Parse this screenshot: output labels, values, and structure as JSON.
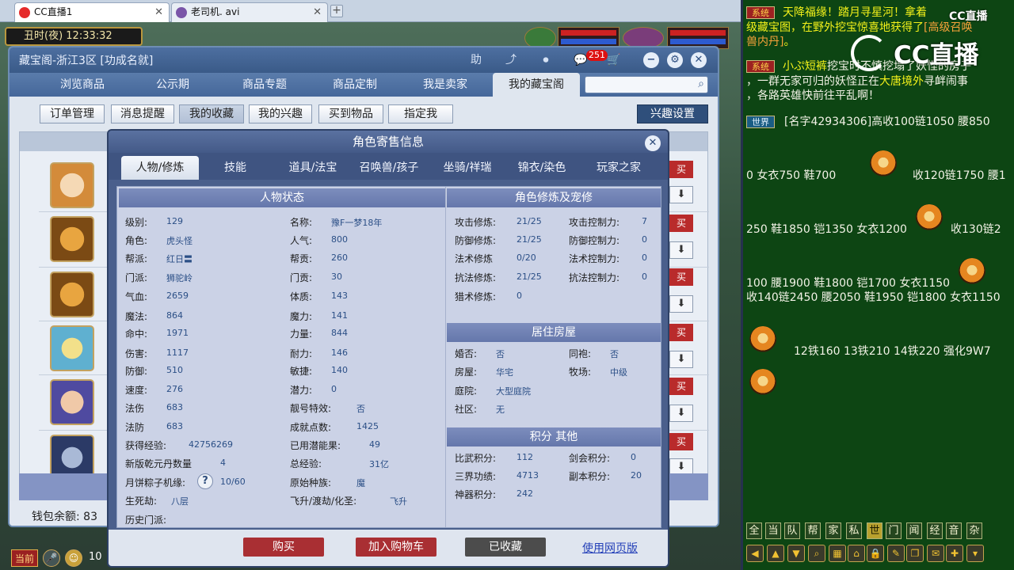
{
  "browser": {
    "tabs": [
      {
        "label": "CC直播1",
        "active": true
      },
      {
        "label": "老司机. avi",
        "active": false
      }
    ],
    "new_tab": "+"
  },
  "game": {
    "clock": "丑时(夜)  12:33:32"
  },
  "window": {
    "title": "藏宝阁-浙江3区 [功成名就]",
    "header_icons": [
      "助",
      "⤴",
      "⏺",
      "💬",
      "🛒"
    ],
    "cart_badge": "251",
    "nav": [
      {
        "label": "浏览商品"
      },
      {
        "label": "公示期"
      },
      {
        "label": "商品专题"
      },
      {
        "label": "商品定制"
      },
      {
        "label": "我是卖家"
      },
      {
        "label": "我的藏宝阁"
      }
    ],
    "search_placeholder": "",
    "subnav": [
      {
        "label": "订单管理"
      },
      {
        "label": "消息提醒"
      },
      {
        "label": "我的收藏"
      },
      {
        "label": "我的兴趣"
      },
      {
        "label": "买到物品"
      },
      {
        "label": "指定我"
      }
    ],
    "interest_button": "兴趣设置",
    "row_buttons": [
      "买",
      "⬇"
    ],
    "wallet_label": "钱包余额: 83"
  },
  "modal": {
    "title": "角色寄售信息",
    "close": "✕",
    "tabs": [
      {
        "label": "人物/修炼"
      },
      {
        "label": "技能"
      },
      {
        "label": "道具/法宝"
      },
      {
        "label": "召唤兽/孩子"
      },
      {
        "label": "坐骑/祥瑞"
      },
      {
        "label": "锦衣/染色"
      },
      {
        "label": "玩家之家"
      }
    ],
    "status": {
      "header": "人物状态",
      "left": [
        {
          "k": "级别:",
          "v": "129"
        },
        {
          "k": "角色:",
          "v": "虎头怪"
        },
        {
          "k": "帮派:",
          "v": "红日〓"
        },
        {
          "k": "门派:",
          "v": "狮驼岭"
        },
        {
          "k": "气血:",
          "v": "2659"
        },
        {
          "k": "魔法:",
          "v": "864"
        },
        {
          "k": "命中:",
          "v": "1971"
        },
        {
          "k": "伤害:",
          "v": "1117"
        },
        {
          "k": "防御:",
          "v": "510"
        },
        {
          "k": "速度:",
          "v": "276"
        },
        {
          "k": "法伤",
          "v": "683"
        },
        {
          "k": "法防",
          "v": "683"
        },
        {
          "k": "获得经验:",
          "v": "42756269"
        },
        {
          "k": "新版乾元丹数量",
          "v": "4"
        },
        {
          "k": "月饼粽子机缘:",
          "v": "10/60"
        },
        {
          "k": "生死劫:",
          "v": "八层"
        },
        {
          "k": "历史门派:",
          "v": ""
        }
      ],
      "right": [
        {
          "k": "名称:",
          "v": "豫F一梦18年"
        },
        {
          "k": "人气:",
          "v": "800"
        },
        {
          "k": "帮贡:",
          "v": "260"
        },
        {
          "k": "门贡:",
          "v": "30"
        },
        {
          "k": "体质:",
          "v": "143"
        },
        {
          "k": "魔力:",
          "v": "141"
        },
        {
          "k": "力量:",
          "v": "844"
        },
        {
          "k": "耐力:",
          "v": "146"
        },
        {
          "k": "敏捷:",
          "v": "140"
        },
        {
          "k": "潜力:",
          "v": "0"
        },
        {
          "k": "靓号特效:",
          "v": "否"
        },
        {
          "k": "成就点数:",
          "v": "1425"
        },
        {
          "k": "已用潜能果:",
          "v": "49"
        },
        {
          "k": "总经验:",
          "v": "31亿"
        },
        {
          "k": "原始种族:",
          "v": "魔"
        },
        {
          "k": "飞升/渡劫/化圣:",
          "v": "飞升"
        }
      ],
      "help": "?"
    },
    "cultivation": {
      "header": "角色修炼及宠修",
      "rows": [
        {
          "k": "攻击修炼:",
          "v": "21/25",
          "k2": "攻击控制力:",
          "v2": "7"
        },
        {
          "k": "防御修炼:",
          "v": "21/25",
          "k2": "防御控制力:",
          "v2": "0"
        },
        {
          "k": "法术修炼",
          "v": "0/20",
          "k2": "法术控制力:",
          "v2": "0"
        },
        {
          "k": "抗法修炼:",
          "v": "21/25",
          "k2": "抗法控制力:",
          "v2": "0"
        },
        {
          "k": "猎术修炼:",
          "v": "0",
          "k2": "",
          "v2": ""
        }
      ]
    },
    "house": {
      "header": "居住房屋",
      "rows": [
        {
          "k": "婚否:",
          "v": "否",
          "k2": "同袍:",
          "v2": "否"
        },
        {
          "k": "房屋:",
          "v": "华宅",
          "k2": "牧场:",
          "v2": "中级"
        },
        {
          "k": "庭院:",
          "v": "大型庭院",
          "k2": "",
          "v2": ""
        },
        {
          "k": "社区:",
          "v": "无",
          "k2": "",
          "v2": ""
        }
      ]
    },
    "points": {
      "header": "积分 其他",
      "rows": [
        {
          "k": "比武积分:",
          "v": "112",
          "k2": "剑会积分:",
          "v2": "0"
        },
        {
          "k": "三界功绩:",
          "v": "4713",
          "k2": "副本积分:",
          "v2": "20"
        },
        {
          "k": "神器积分:",
          "v": "242",
          "k2": "",
          "v2": ""
        }
      ]
    },
    "footer": {
      "buy": "购买",
      "add_cart": "加入购物车",
      "collected": "已收藏",
      "web": "使用网页版"
    }
  },
  "bottom": {
    "current_channel": "当前",
    "page": "10"
  },
  "chat": {
    "messages": [
      {
        "channel": "系统",
        "parts": [
          {
            "t": "天降福缘！踏月寻星河！拿着",
            "c": "yel"
          },
          {
            "t": "级藏宝图，在野外挖宝惊喜地获得了",
            "c": "yel"
          },
          {
            "t": "[高级召唤",
            "c": "org"
          },
          {
            "t": "兽内丹]",
            "c": "org"
          },
          {
            "t": "。",
            "c": "yel"
          }
        ]
      },
      {
        "channel": "系统",
        "parts": [
          {
            "t": "小ぷ短裤",
            "c": "yel"
          },
          {
            "t": "挖宝时不慎挖塌了妖怪的房子",
            "c": "wht"
          },
          {
            "t": "，一群无家可归的妖怪正在",
            "c": "wht"
          },
          {
            "t": "大唐境外",
            "c": "yel"
          },
          {
            "t": "寻衅闹事",
            "c": "wht"
          },
          {
            "t": "，各路英雄快前往平乱啊！",
            "c": "wht"
          }
        ]
      },
      {
        "channel": "世界",
        "parts": [
          {
            "t": "[名字42934306]高收100链1050 腰850",
            "c": "wht"
          }
        ]
      }
    ],
    "lines": [
      "0 女衣750 鞋700",
      "收120链1750 腰1",
      "250 鞋1850 铠1350 女衣1200",
      "收130链2",
      "100 腰1900 鞋1800 铠1700 女衣1150",
      "收140链2450 腰2050 鞋1950 铠1800 女衣1150",
      "12铁160 13铁210 14铁220 强化9W7"
    ],
    "watermark": "CC直播",
    "watermark_small": "CC直播",
    "channel_tabs": [
      "全",
      "当",
      "队",
      "帮",
      "家",
      "私",
      "世",
      "门",
      "闻",
      "经",
      "音",
      "杂"
    ],
    "active_tab": "世"
  },
  "colors": {
    "accent": "#4a5f8c",
    "buy_red": "#b13030",
    "chat_bg": "#0d4513"
  }
}
